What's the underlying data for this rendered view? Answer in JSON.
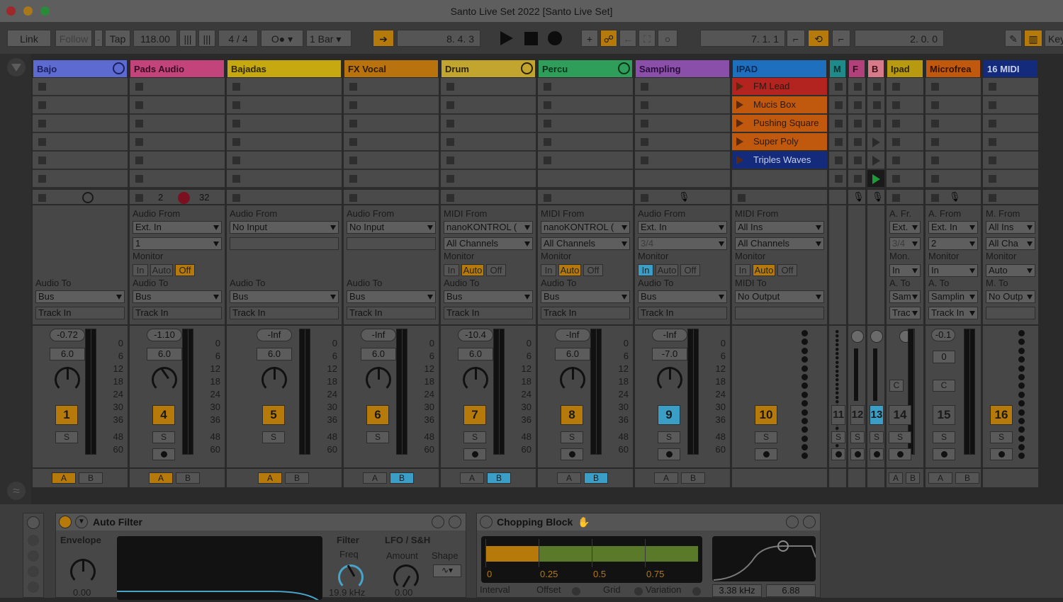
{
  "window": {
    "title": "Santo Live Set 2022  [Santo Live Set]"
  },
  "toolbar": {
    "link": "Link",
    "follow": "Follow",
    "dash": "-",
    "tap": "Tap",
    "tempo": "118.00",
    "nudge_down": "|||",
    "nudge_up": "|||",
    "signature": "4 / 4",
    "metronome": "O●",
    "quantize": "1 Bar",
    "position": "8.   4.   3",
    "loop_start": "7.   1.   1",
    "loop_length": "2.   0.   0",
    "keys_label": "Key"
  },
  "tracks": [
    {
      "name": "Bajo",
      "color": "#5d6bd0",
      "text_color": "#1a2060",
      "kind": "group"
    },
    {
      "name": "Pads Audio",
      "color": "#c2447a",
      "text_color": "#3a0b22",
      "kind": "audio",
      "from_label": "Audio From",
      "from": "Ext. In",
      "sub": "1",
      "to_label": "Audio To",
      "to": "Bus",
      "to_sub": "Track In",
      "monitor": "Off",
      "vol": "-1.10",
      "send": "6.0",
      "number": "4",
      "xfade": "A",
      "clip_count": "2",
      "clip_total": "32"
    },
    {
      "name": "Bajadas",
      "color": "#c6a810",
      "text_color": "#2e2700",
      "kind": "audio",
      "from_label": "Audio From",
      "from": "No Input",
      "sub": "",
      "to_label": "Audio To",
      "to": "Bus",
      "to_sub": "Track In",
      "monitor": "",
      "vol": "-Inf",
      "send": "6.0",
      "number": "5",
      "xfade": "A"
    },
    {
      "name": "FX Vocal",
      "color": "#b8720e",
      "text_color": "#2e1a00",
      "kind": "audio",
      "from_label": "Audio From",
      "from": "No Input",
      "sub": "",
      "to_label": "Audio To",
      "to": "Bus",
      "to_sub": "Track In",
      "monitor": "",
      "vol": "-Inf",
      "send": "6.0",
      "number": "6",
      "xfade": "B"
    },
    {
      "name": "Drum",
      "color": "#c2a52e",
      "text_color": "#2b2200",
      "kind": "midi",
      "from_label": "MIDI From",
      "from": "nanoKONTROL (",
      "sub": "All Channels",
      "to_label": "Audio To",
      "to": "Bus",
      "to_sub": "Track In",
      "monitor": "Auto",
      "vol": "-10.4",
      "send": "6.0",
      "number": "7",
      "xfade": "B"
    },
    {
      "name": "Percu",
      "color": "#2f9e5a",
      "text_color": "#06331a",
      "kind": "midi",
      "from_label": "MIDI From",
      "from": "nanoKONTROL (",
      "sub": "All Channels",
      "to_label": "Audio To",
      "to": "Bus",
      "to_sub": "Track In",
      "monitor": "Auto",
      "vol": "-Inf",
      "send": "6.0",
      "number": "8",
      "xfade": "B"
    },
    {
      "name": "Sampling",
      "color": "#8a4fa8",
      "text_color": "#2a0c3a",
      "kind": "audio",
      "from_label": "Audio From",
      "from": "Ext. In",
      "sub": "3/4",
      "to_label": "Audio To",
      "to": "Bus",
      "to_sub": "Track In",
      "monitor": "In",
      "vol": "-Inf",
      "send": "-7.0",
      "number": "9",
      "xfade": ""
    },
    {
      "name": "IPAD",
      "color": "#1f6fbf",
      "text_color": "#0a2a55",
      "kind": "midi",
      "from_label": "MIDI From",
      "from": "All Ins",
      "sub": "All Channels",
      "to_label": "MIDI To",
      "to": "No Output",
      "to_sub": "",
      "monitor": "Auto",
      "number": "10",
      "clips": [
        {
          "name": "FM Lead",
          "color": "#b3231f"
        },
        {
          "name": "Mucis Box",
          "color": "#c0580e"
        },
        {
          "name": "Pushing Square",
          "color": "#c0580e"
        },
        {
          "name": "Super Poly",
          "color": "#c0580e"
        },
        {
          "name": "Triples Waves",
          "color": "#142a7a"
        }
      ]
    },
    {
      "name": "M",
      "color": "#1f8a8a",
      "text_color": "#063030",
      "number": "11"
    },
    {
      "name": "F",
      "color": "#b2407a",
      "text_color": "#33091f",
      "number": "12"
    },
    {
      "name": "B",
      "color": "#d77a8a",
      "text_color": "#3a0d16",
      "number": "13"
    },
    {
      "name": "Ipad",
      "color": "#b89a10",
      "text_color": "#2b2400",
      "number": "14",
      "from_label": "A. Fr.",
      "from": "Ext.",
      "sub": "3/4",
      "mon_label": "Mon.",
      "monitor": "In",
      "to_label": "A. To",
      "to": "Sam",
      "to_sub": "Trac"
    },
    {
      "name": "Microfrea",
      "color": "#c0580e",
      "text_color": "#331300",
      "number": "15",
      "from_label": "A. From",
      "from": "Ext. In",
      "sub": "2",
      "mon_label": "Monitor",
      "monitor": "In",
      "to_label": "A. To",
      "to": "Samplin",
      "to_sub": "Track In",
      "vol": "-0.1",
      "send": "0"
    },
    {
      "name": "16 MIDI",
      "color": "#142a7a",
      "text_color": "#c8d0f0",
      "number": "16",
      "from_label": "M. From",
      "from": "All Ins",
      "sub": "All Cha",
      "mon_label": "Monitor",
      "monitor": "Auto",
      "to_label": "M. To",
      "to": "No Outp"
    }
  ],
  "bajo": {
    "to_label": "Audio To",
    "to": "Bus",
    "to_sub": "Track In",
    "vol": "-0.72",
    "send": "6.0",
    "number": "1",
    "xfade": "A"
  },
  "monitor_options": {
    "in": "In",
    "auto": "Auto",
    "off": "Off"
  },
  "meter_scale": [
    "0",
    "6",
    "12",
    "18",
    "24",
    "30",
    "36",
    "48",
    "60"
  ],
  "solo_label": "S",
  "cue_label": "C",
  "xfade_labels": {
    "a": "A",
    "b": "B"
  },
  "devices": {
    "auto_filter": {
      "title": "Auto Filter",
      "envelope": "Envelope",
      "envelope_value": "0.00",
      "filter": "Filter",
      "freq": "Freq",
      "freq_value": "19.9 kHz",
      "lfo": "LFO / S&H",
      "amount": "Amount",
      "amount_value": "0.00",
      "shape": "Shape"
    },
    "chopping_block": {
      "title": "Chopping Block",
      "ticks": [
        "0",
        "0.25",
        "0.5",
        "0.75"
      ],
      "interval": "Interval",
      "offset": "Offset",
      "grid": "Grid",
      "variation": "Variation",
      "freq_value": "3.38 kHz",
      "q_value": "6.88",
      "chop_fraction": 0.25
    }
  }
}
